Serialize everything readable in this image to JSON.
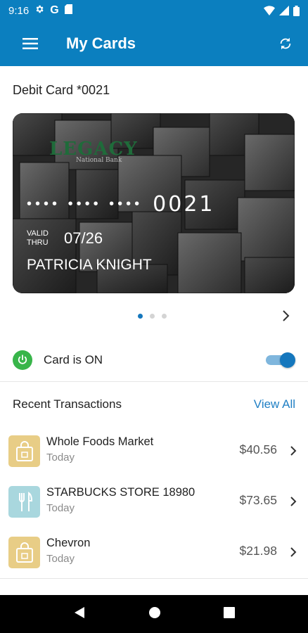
{
  "status_bar": {
    "time": "9:16",
    "left_icons": [
      "gear-icon",
      "google-icon",
      "sd-card-icon"
    ],
    "right_icons": [
      "wifi-icon",
      "signal-icon",
      "battery-icon"
    ]
  },
  "app_bar": {
    "title": "My Cards",
    "menu_icon": "hamburger-menu-icon",
    "refresh_icon": "refresh-icon",
    "color": "#0b7fbf"
  },
  "card": {
    "header": "Debit Card *0021",
    "bank_logo": "LEGACY",
    "bank_subtitle": "National Bank",
    "masked_groups": "•••• •••• ••••",
    "last4": "0021",
    "valid_thru": "VALID\nTHRU",
    "expiry": "07/26",
    "cardholder": "PATRICIA KNIGHT"
  },
  "pager": {
    "count": 3,
    "active_index": 0
  },
  "card_toggle": {
    "label": "Card is ON",
    "on": true,
    "icon": "power-icon"
  },
  "transactions": {
    "header": "Recent Transactions",
    "view_all": "View All",
    "items": [
      {
        "name": "Whole Foods Market",
        "date": "Today",
        "amount": "$40.56",
        "icon": "shopping-bag-icon",
        "icon_color": "#e8cd86"
      },
      {
        "name": "STARBUCKS STORE 18980",
        "date": "Today",
        "amount": "$73.65",
        "icon": "fork-knife-icon",
        "icon_color": "#a9d7de"
      },
      {
        "name": "Chevron",
        "date": "Today",
        "amount": "$21.98",
        "icon": "shopping-bag-icon",
        "icon_color": "#e8cd86"
      }
    ]
  },
  "nav_bar": {
    "items": [
      "back-icon",
      "home-icon",
      "recents-icon"
    ]
  }
}
